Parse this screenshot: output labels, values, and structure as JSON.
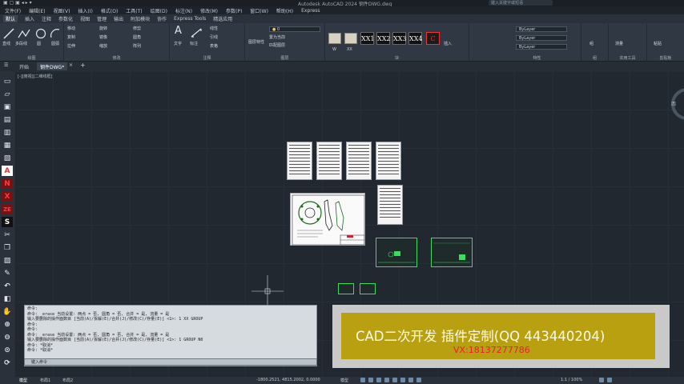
{
  "window": {
    "title": "Autodesk AutoCAD 2024   钢件DWG.dwg",
    "search_placeholder": "键入关键字或短语"
  },
  "menubar": [
    "文件(F)",
    "编辑(E)",
    "视图(V)",
    "插入(I)",
    "格式(O)",
    "工具(T)",
    "绘图(D)",
    "标注(N)",
    "修改(M)",
    "参数(P)",
    "窗口(W)",
    "帮助(H)",
    "Express"
  ],
  "ribbon_tabs": [
    "默认",
    "插入",
    "注释",
    "参数化",
    "视图",
    "管理",
    "输出",
    "附加模块",
    "协作",
    "Express Tools",
    "精选应用"
  ],
  "ribbon_tabs_active": "默认",
  "ribbon": {
    "panels": [
      "绘图",
      "修改",
      "注释",
      "图层",
      "块",
      "特性",
      "组",
      "实用工具",
      "剪贴板"
    ],
    "draw_tools": [
      "直线",
      "多段线",
      "圆",
      "圆弧"
    ],
    "modify_tools": [
      "移动",
      "旋转",
      "修剪",
      "复制",
      "镜像",
      "圆角",
      "拉伸",
      "缩放",
      "阵列"
    ],
    "annotation_tools": [
      "文字",
      "标注",
      "线性",
      "引线",
      "表格"
    ],
    "layer_value": "0",
    "layer_tools": [
      "图层特性",
      "置为当前",
      "匹配图层"
    ],
    "block_thumbs": [
      "W",
      "XX",
      "XX1",
      "XX2",
      "XX3",
      "XX4"
    ],
    "block_tools": [
      "插入",
      "C"
    ],
    "properties": [
      "ByLayer",
      "ByLayer",
      "ByLayer"
    ],
    "group_label": "组",
    "utility_label": "测量",
    "clipboard_label": "粘贴"
  },
  "doc_tabs": [
    {
      "label": "开始",
      "active": false
    },
    {
      "label": "钢件DWG*",
      "active": true
    }
  ],
  "viewport_label": "[-][俯视][二维线框]",
  "palette_letters": [
    "A",
    "N",
    "X",
    "ZE",
    "S"
  ],
  "command_history": [
    "命令:",
    "命令: _erase 当前设置: 两点 = 否, 圆角 = 否, 合并 = 是, 流量 = 是",
    "输入要删除的操作面数目 [当前(A)/拆解(E)/合并(J)/修改(C)/存量(E)] <1>: 1  XX GROUP",
    "命令:",
    "命令:",
    "命令: _erase 当前设置: 两点 = 否, 圆角 = 否, 合并 = 是, 流量 = 是",
    "输入要删除的操作面数目 [当前(A)/拆解(E)/合并(J)/修改(C)/存量(E)] <1>: 1  GROUP N0",
    "命令: *取消*",
    "命令: *取消*"
  ],
  "command_prompt": "键入命令",
  "banner": {
    "title": "CAD二次开发 插件定制(QQ 443440204)",
    "contact": "VX:18137277786"
  },
  "statusbar": {
    "tabs": [
      "模型",
      "布局1",
      "布局2"
    ],
    "coords": "-1800.2521, 4815.2002, 0.0000",
    "mode": "模型",
    "scale": "1:1 / 100%"
  },
  "viewcube_label": "西"
}
